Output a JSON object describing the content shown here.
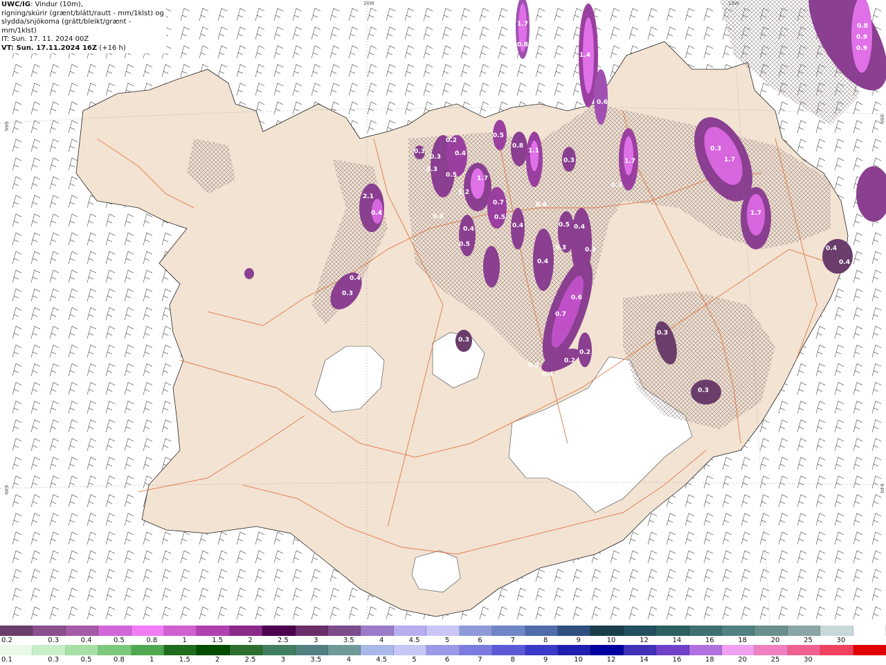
{
  "info": {
    "product": "UWC/IG",
    "line1_rest": ": Vindur (10m),",
    "line2": "rigning/skúrir (grænt/blátt/rautt - mm/1klst) og",
    "line3": "slydda/snjókoma (grátt/bleikt/grænt - mm/1klst)",
    "line4": "IT: Sun. 17. 11. 2024 00Z",
    "line5_bold": "VT: Sun. 17.11.2024 16Z",
    "line5_rest": " (+16 h)"
  },
  "grid_labels": {
    "top_20w": "20W",
    "top_15w": "15W",
    "left_66n": "66N",
    "left_64n": "64N",
    "right_66n": "66N",
    "right_64n": "64N"
  },
  "precip_labels": [
    "1.7",
    "0.8",
    "1.4",
    "0.6",
    "0.3",
    "0.3",
    "0.3",
    "0.4",
    "0.2",
    "0.5",
    "1.2",
    "1.7",
    "0.5",
    "0.8",
    "1.1",
    "0.3",
    "1.7",
    "0.3",
    "1.7",
    "1.7",
    "2.1",
    "0.4",
    "0.7",
    "0.5",
    "0.4",
    "0.4",
    "0.5",
    "0.5",
    "0.3",
    "0.4",
    "0.4",
    "0.4",
    "0.4",
    "0.3",
    "0.2",
    "0.4",
    "0.4",
    "0.3",
    "0.6",
    "0.7",
    "0.3",
    "0.2",
    "0.2",
    "0.3",
    "0.3",
    "0.4",
    "0.4",
    "0.3",
    "0.8",
    "0.9",
    "0.9"
  ],
  "legend_snow": {
    "colors": [
      "#6b3d6b",
      "#8a4f8f",
      "#a55aa8",
      "#d266d8",
      "#f07cf5",
      "#d060d0",
      "#b040b0",
      "#8c2a8c",
      "#4d004d",
      "#6a2f6a",
      "#7d4a8a",
      "#9a7cc8",
      "#b7adf0",
      "#c9c6f7",
      "#8f9ad8",
      "#6f86c8",
      "#4f6ba8",
      "#2e4f7f",
      "#1a3d4a",
      "#244f5f",
      "#2e6060",
      "#3f6f6f",
      "#527f7f",
      "#6a8f8f",
      "#8aa6a6",
      "#c8d8d8",
      "#ffffff"
    ],
    "ticks": [
      "0.2",
      "0.3",
      "0.4",
      "0.5",
      "0.8",
      "1",
      "1.5",
      "2",
      "2.5",
      "3",
      "3.5",
      "4",
      "4.5",
      "5",
      "6",
      "7",
      "8",
      "9",
      "10",
      "12",
      "14",
      "16",
      "18",
      "20",
      "25",
      "30"
    ]
  },
  "legend_rain": {
    "colors": [
      "#e8fae8",
      "#c8f0c8",
      "#a6e0a6",
      "#7cc87c",
      "#4fa84f",
      "#1e6e1e",
      "#004d00",
      "#2e6e2e",
      "#3f7f5f",
      "#527f7f",
      "#6f9a9a",
      "#a8b8e8",
      "#c6c6f7",
      "#9a9ae8",
      "#7c7ce0",
      "#5a5ad8",
      "#3a3ac8",
      "#2020b0",
      "#0000a0",
      "#4030b8",
      "#7040c8",
      "#b070e0",
      "#f0a0f0",
      "#f080c0",
      "#f06090",
      "#f04060",
      "#e00000"
    ],
    "ticks": [
      "0.1",
      "0.3",
      "0.5",
      "0.8",
      "1",
      "1.5",
      "2",
      "2.5",
      "3",
      "3.5",
      "4",
      "4.5",
      "5",
      "6",
      "7",
      "8",
      "9",
      "10",
      "12",
      "14",
      "16",
      "18",
      "20",
      "25",
      "30"
    ]
  }
}
